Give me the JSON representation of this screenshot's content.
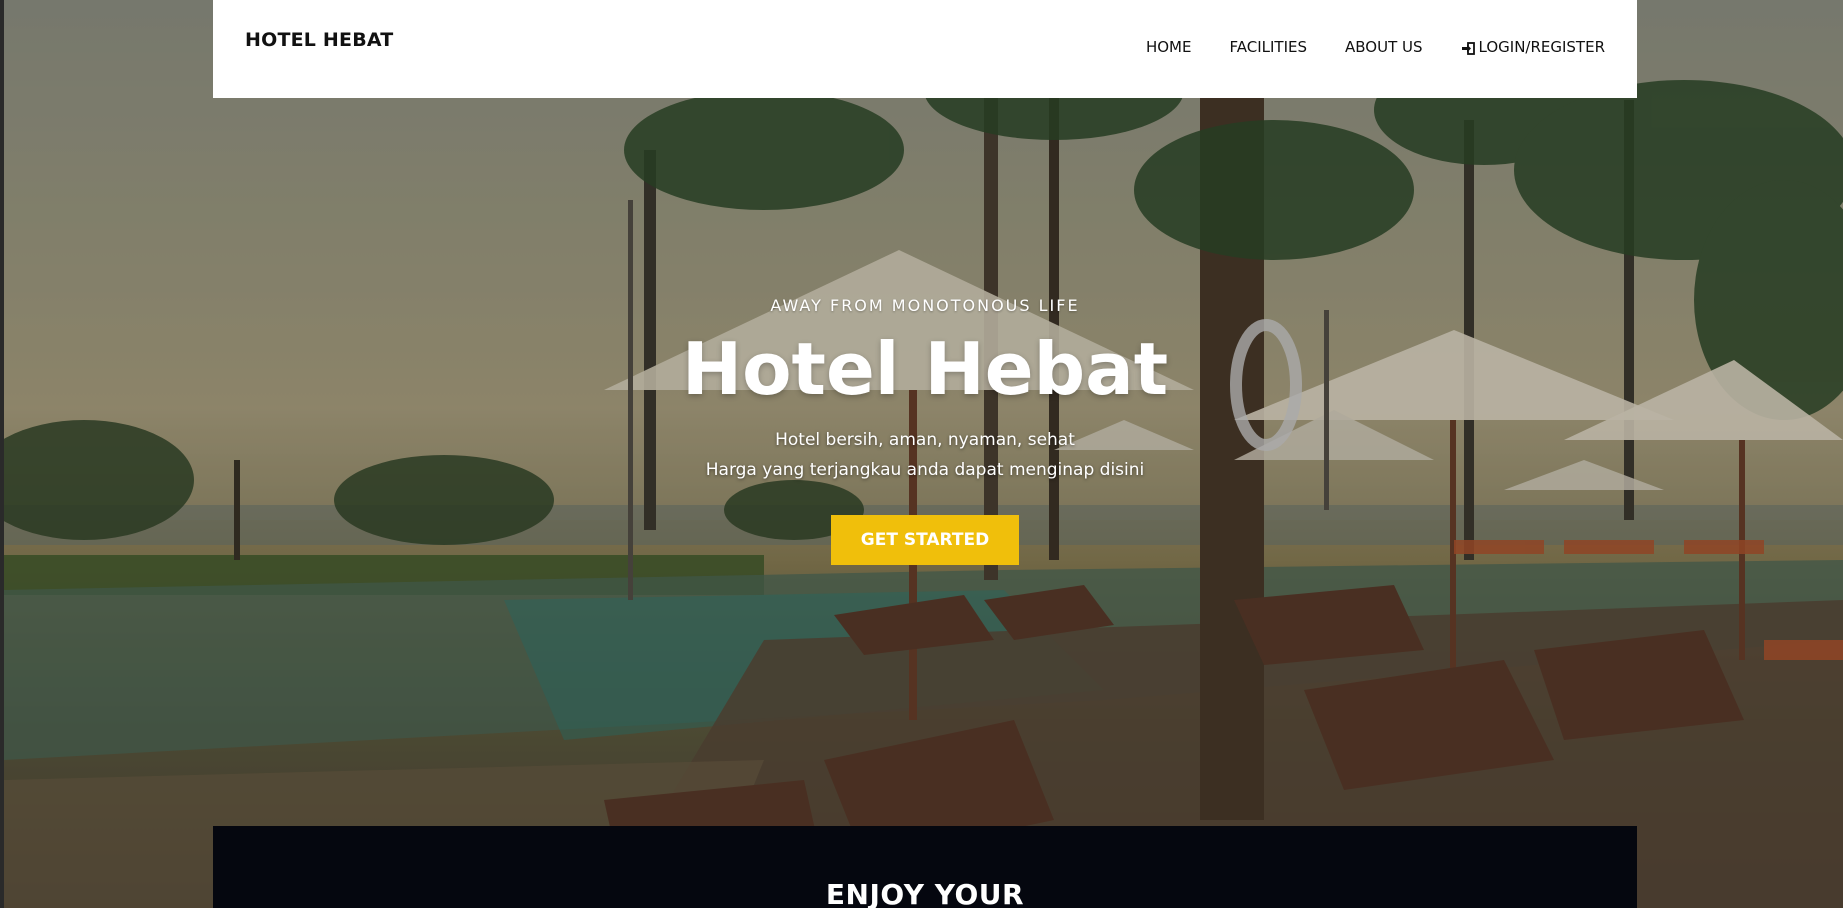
{
  "brand": "HOTEL HEBAT",
  "nav": {
    "home": "HOME",
    "facilities": "FACILITIES",
    "about": "ABOUT US",
    "login": "LOGIN/REGISTER"
  },
  "hero": {
    "tagline": "AWAY FROM MONOTONOUS LIFE",
    "title": "Hotel Hebat",
    "line1": "Hotel bersih, aman, nyaman, sehat",
    "line2": "Harga yang terjangkau anda dapat menginap disini",
    "cta": "GET STARTED"
  },
  "section": {
    "heading": "ENJOY YOUR"
  },
  "colors": {
    "accent": "#f0bf0b",
    "dark_panel": "#05070f",
    "navbar": "#ffffff"
  },
  "icons": {
    "login": "sign-in-icon"
  }
}
